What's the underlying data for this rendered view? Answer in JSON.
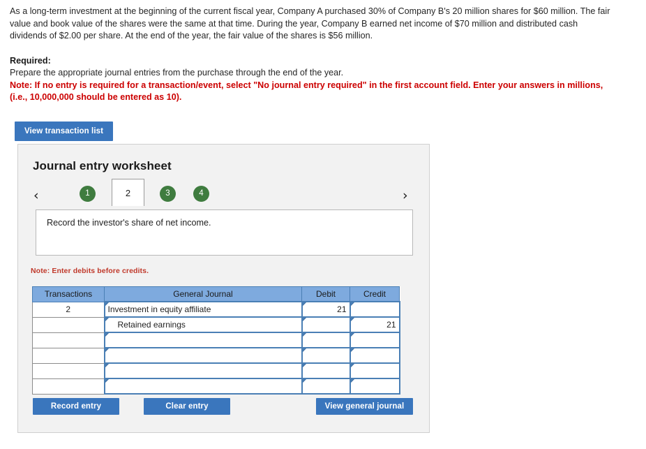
{
  "problem": {
    "paragraph": "As a long-term investment at the beginning of the current fiscal year, Company A purchased 30% of Company B's 20 million shares for $60 million. The fair value and book value of the shares were the same at that time. During the year, Company B earned net income of $70 million and distributed cash dividends of $2.00 per share. At the end of the year, the fair value of the shares is $56 million.",
    "required_label": "Required:",
    "required_text": "Prepare the appropriate journal entries from the purchase through the end of the year.",
    "note": "Note: If no entry is required for a transaction/event, select \"No journal entry required\" in the first account field. Enter your answers in millions, (i.e., 10,000,000 should be entered as 10)."
  },
  "toolbar": {
    "view_transaction_list_label": "View transaction list"
  },
  "worksheet": {
    "title": "Journal entry worksheet",
    "prev_arrow": "‹",
    "next_arrow": "›",
    "tabs": [
      {
        "label": "1",
        "state": "complete"
      },
      {
        "label": "2",
        "state": "active"
      },
      {
        "label": "3",
        "state": "complete"
      },
      {
        "label": "4",
        "state": "complete"
      }
    ],
    "prompt": "Record the investor's share of net income.",
    "credits_note": "Note: Enter debits before credits."
  },
  "journal": {
    "headers": [
      "Transactions",
      "General Journal",
      "Debit",
      "Credit"
    ],
    "rows": [
      {
        "transaction": "2",
        "account": "Investment in equity affiliate",
        "indent": false,
        "debit": "21",
        "credit": ""
      },
      {
        "transaction": "",
        "account": "Retained earnings",
        "indent": true,
        "debit": "",
        "credit": "21"
      },
      {
        "transaction": "",
        "account": "",
        "indent": false,
        "debit": "",
        "credit": ""
      },
      {
        "transaction": "",
        "account": "",
        "indent": false,
        "debit": "",
        "credit": ""
      },
      {
        "transaction": "",
        "account": "",
        "indent": false,
        "debit": "",
        "credit": ""
      },
      {
        "transaction": "",
        "account": "",
        "indent": false,
        "debit": "",
        "credit": ""
      }
    ]
  },
  "actions": {
    "record_entry_label": "Record entry",
    "clear_entry_label": "Clear entry",
    "view_general_journal_label": "View general journal"
  },
  "colors": {
    "button_blue": "#3a76bd",
    "tab_green": "#3f7c3f",
    "header_blue": "#7eaade",
    "note_red": "#cc0000",
    "panel_gray": "#f2f2f2"
  }
}
